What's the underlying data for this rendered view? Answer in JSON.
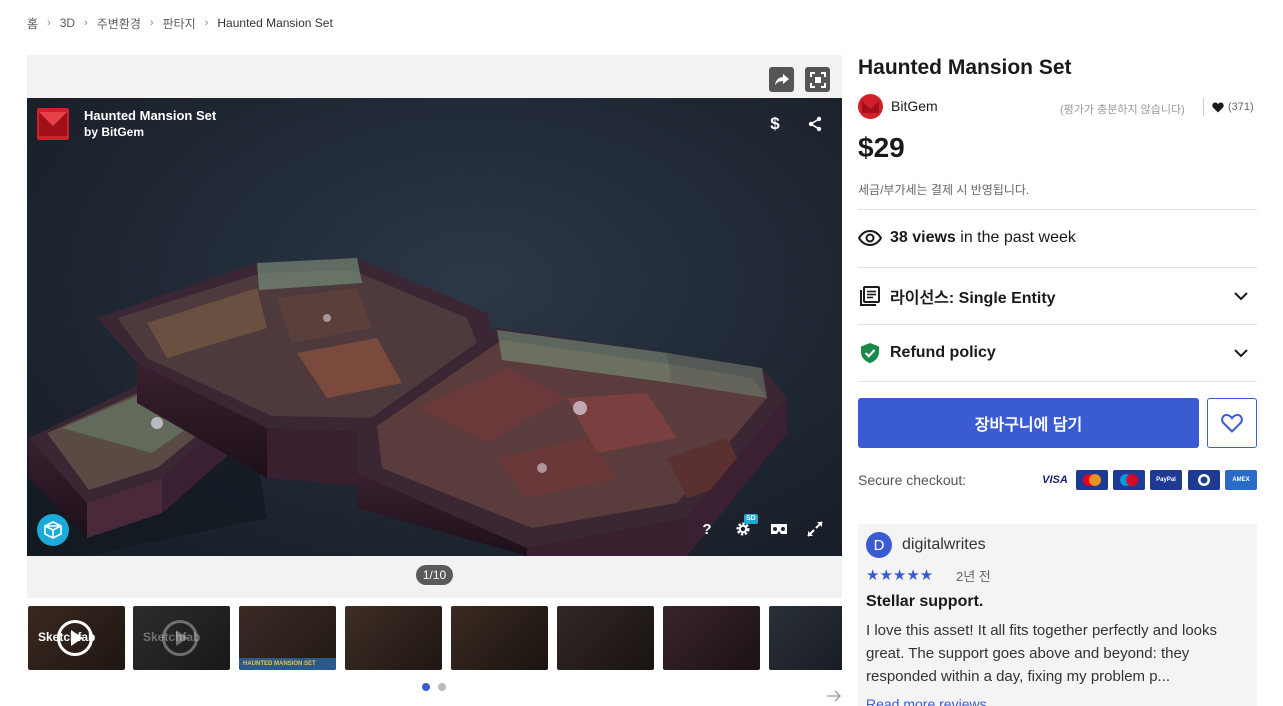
{
  "breadcrumb": {
    "items": [
      "홈",
      "3D",
      "주변환경",
      "판타지"
    ],
    "current": "Haunted Mansion Set"
  },
  "viewer": {
    "title": "Haunted Mansion Set",
    "by": "by BitGem",
    "price_icon": "$",
    "help_icon": "?",
    "sd_badge": "SD",
    "counter": "1/10"
  },
  "thumbnails": {
    "video_label": "Sketchfab",
    "banner_text": "HAUNTED MANSION SET",
    "pages": 2,
    "active_page": 1
  },
  "product": {
    "title": "Haunted Mansion Set",
    "seller": "BitGem",
    "rating_note": "(평가가 충분하지 않습니다)",
    "likes": "(371)",
    "price": "$29",
    "tax_note": "세금/부가세는 결제 시 반영됩니다."
  },
  "stats": {
    "views_bold": "38 views",
    "views_rest": " in the past week"
  },
  "license": {
    "label": "라이선스: Single Entity"
  },
  "refund": {
    "label": "Refund policy"
  },
  "actions": {
    "cart_label": "장바구니에 담기"
  },
  "checkout": {
    "label": "Secure checkout:",
    "methods": [
      "VISA",
      "Mastercard",
      "Maestro",
      "PayPal",
      "Diners",
      "AMEX"
    ]
  },
  "review": {
    "avatar_letter": "D",
    "user": "digitalwrites",
    "stars": "★★★★★",
    "rating": 5,
    "time": "2년 전",
    "title": "Stellar support.",
    "body": "I love this asset! It all fits together perfectly and looks great. The support goes above and beyond: they responded within a day, fixing my problem p...",
    "more": "Read more reviews"
  },
  "colors": {
    "accent": "#3a5bd1",
    "brand_red": "#d0202a",
    "refund_green": "#1a8a4a",
    "sketchfab_blue": "#1caad9"
  }
}
